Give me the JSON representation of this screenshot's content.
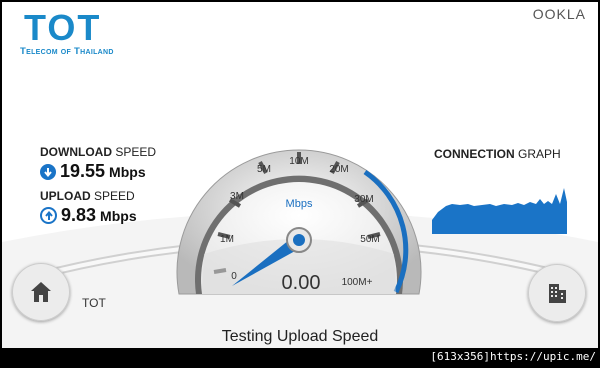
{
  "brand": {
    "logo_text": "TOT",
    "subtitle": "Telecom of Thailand",
    "ookla": "OOKLA"
  },
  "download": {
    "title_bold": "DOWNLOAD",
    "title_rest": " SPEED",
    "value": "19.55",
    "unit": "Mbps"
  },
  "upload": {
    "title_bold": "UPLOAD",
    "title_rest": " SPEED",
    "value": "9.83",
    "unit": "Mbps"
  },
  "connection": {
    "title_bold": "CONNECTION",
    "title_rest": " GRAPH"
  },
  "gauge": {
    "unit_label": "Mbps",
    "reading": "0.00",
    "scale_labels": [
      "0",
      "1M",
      "3M",
      "5M",
      "10M",
      "20M",
      "30M",
      "50M",
      "100M+"
    ],
    "accent_color": "#1a6fc0"
  },
  "isp_label": "TOT",
  "status_text": "Testing Upload Speed",
  "footer": "[613x356]https://upic.me/",
  "icons": {
    "home": "home-icon",
    "business": "building-icon",
    "download": "arrow-down-icon",
    "upload": "arrow-up-icon"
  },
  "colors": {
    "brand_blue": "#1a89c9",
    "graph_blue": "#1a74c7"
  }
}
